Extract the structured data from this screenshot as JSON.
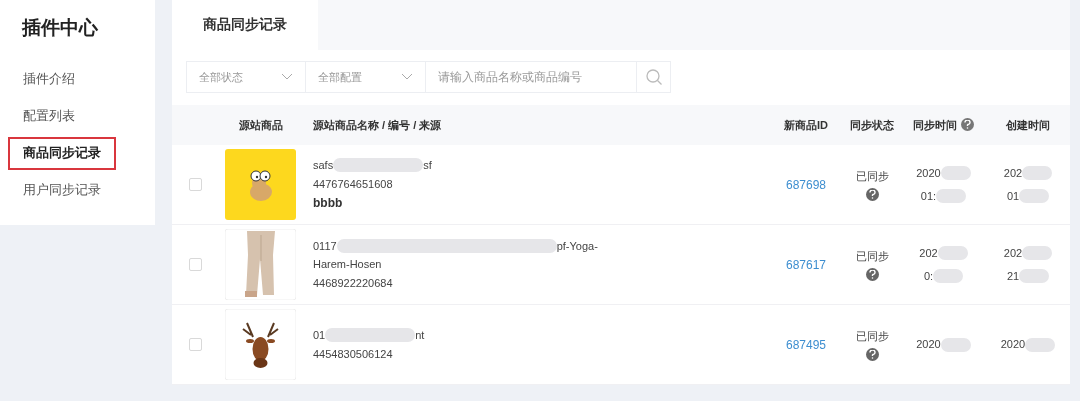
{
  "sidebar": {
    "title": "插件中心",
    "items": [
      {
        "label": "插件介绍",
        "selected": false
      },
      {
        "label": "配置列表",
        "selected": false
      },
      {
        "label": "商品同步记录",
        "selected": true
      },
      {
        "label": "用户同步记录",
        "selected": false
      }
    ]
  },
  "tabs": [
    {
      "label": "商品同步记录",
      "selected": true
    }
  ],
  "filters": {
    "status_select": "全部状态",
    "config_select": "全部配置",
    "search": {
      "placeholder": "请输入商品名称或商品编号"
    }
  },
  "table": {
    "columns": [
      "源站商品",
      "源站商品名称 / 编号 / 来源",
      "新商品ID",
      "同步状态",
      "同步时间",
      "创建时间"
    ],
    "rows": [
      {
        "checked": false,
        "image": {
          "kind": "picture"
        },
        "name_lines": [
          {
            "start": "safs",
            "end": "sf"
          }
        ],
        "code": "4476764651608",
        "source": "bbbb",
        "new_id": "687698",
        "status": "已同步",
        "sync_time": [
          "2020",
          "01:"
        ],
        "create_time": [
          "202",
          "01"
        ]
      },
      {
        "checked": false,
        "image": {
          "kind": "picture"
        },
        "name_lines": [
          {
            "start": "0117",
            "end": "pf-Yoga-"
          },
          {
            "start": "Harem-Hosen"
          }
        ],
        "code": "4468922220684",
        "new_id": "687617",
        "status": "已同步",
        "sync_time": [
          "202",
          "0:"
        ],
        "create_time": [
          "202",
          "21"
        ]
      },
      {
        "checked": false,
        "image": {
          "kind": "picture"
        },
        "name_lines": [
          {
            "start": "01",
            "end": "nt"
          }
        ],
        "code": "4454830506124",
        "new_id": "687495",
        "status": "已同步",
        "sync_time": [
          "2020"
        ],
        "create_time": [
          "2020"
        ]
      }
    ]
  }
}
